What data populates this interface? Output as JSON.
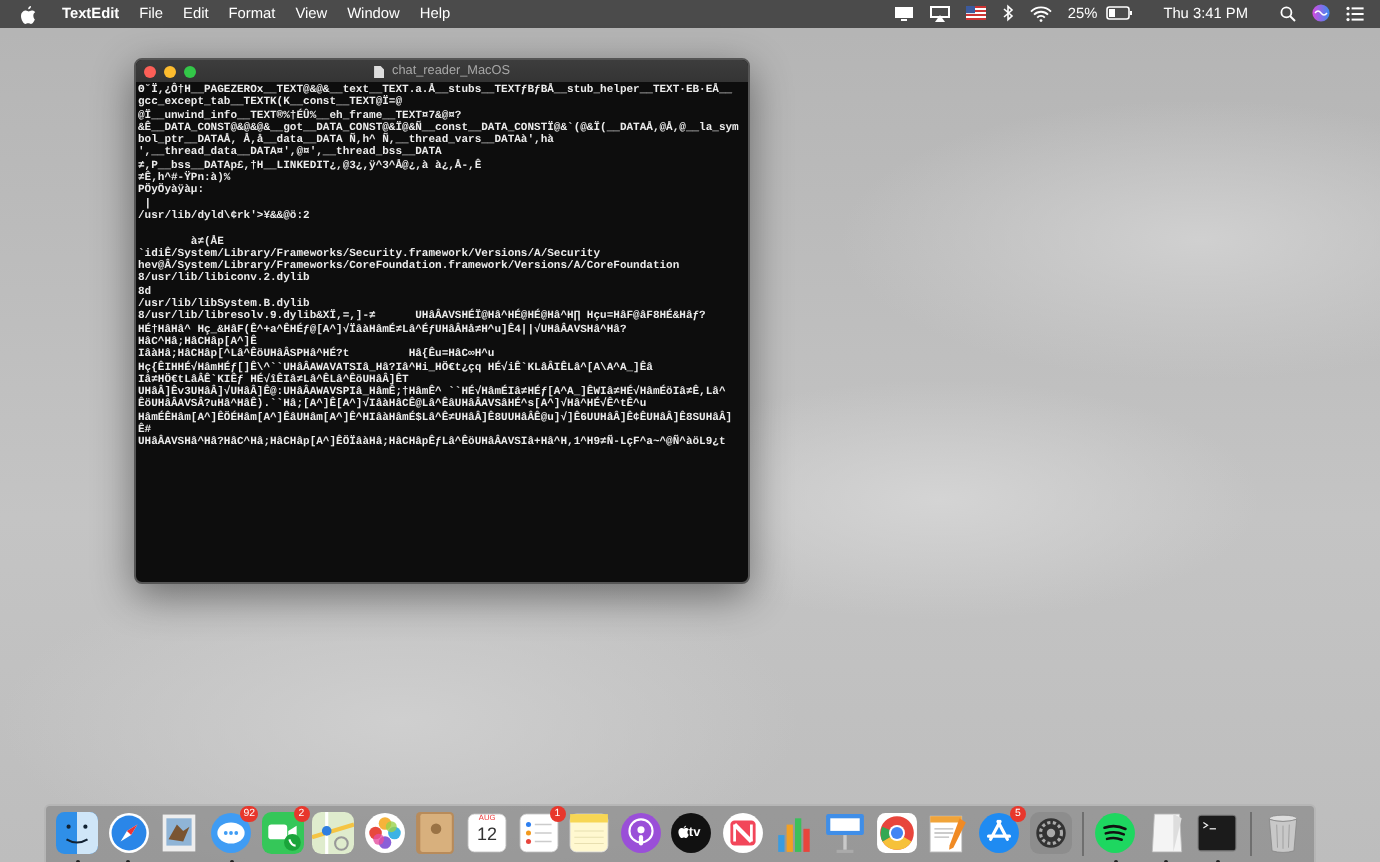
{
  "menu_bar": {
    "app_name": "TextEdit",
    "menus": [
      "File",
      "Edit",
      "Format",
      "View",
      "Window",
      "Help"
    ],
    "battery_percent": "25%",
    "clock": "Thu 3:41 PM"
  },
  "window": {
    "title": "chat_reader_MacOS",
    "lines": [
      "ʘ˘Ï,¿Ô†H__PAGEZEROx__TEXT@&@&__text__TEXT.a.Å__stubs__TEXTƒBƒBÅ__stub_helper__TEXT·EB·EÅ__",
      "gcc_except_tab__TEXTK(K__const__TEXT@Ï=@",
      "@Ï__unwind_info__TEXT®%†ÉÛ%__eh_frame__TEXT¤7&@¤?",
      "&Ê__DATA_CONST@&@&@&__got__DATA_CONST@&Ï@&Ñ__const__DATA_CONSTÏ@&`(@&Ï(__DATAÅ,@Å,@__la_sym",
      "bol_ptr__DATAÅ, Å,å__data__DATA Ñ,h^ Ñ,__thread_vars__DATAà',hà",
      "',__thread_data__DATA¤',@¤',__thread_bss__DATA",
      "≠,P__bss__DATAp£,†H__LINKEDIT¿,@3¿,ÿ^3^Å@¿,à à¿,Å-,Ê",
      "≠Ê,h^#-ŸPn:à)%",
      "PÖyÖyàÿàµ:",
      " |",
      "/usr/lib/dyld\\¢rk'>¥&&@ö:2",
      "        à≠(ÅE",
      "`idiÊ/System/Library/Frameworks/Security.framework/Versions/A/Security",
      "hev@Â/System/Library/Frameworks/CoreFoundation.framework/Versions/A/CoreFoundation",
      "8/usr/lib/libiconv.2.dylib",
      "8d",
      "/usr/lib/libSystem.B.dylib",
      "8/usr/lib/libresolv.9.dylib&XÏ,=,]-≠      UHâÂAVSHÉÏ@Hâ^HÉ@HÉ@Hâ^H∏ Hçu=HâF@âF8HÉ&Hâƒ?",
      "HÉ†HâHâ^ Hç_&HâF(Ê^+a^ÊHÉƒ@[A^]√ÏâàHâmÉ≠Lâ^ÉƒUHâÂHå≠H^u]Ê4||√UHâÂAVSHâ^Hâ?",
      "HâC^Hâ;HâCHâp[A^]Ê",
      "IâàHâ;HâCHâp[^Lâ^ÊöUHâÂSPHâ^HÉ?t         Hâ{Êu=HâC∞H^u",
      "Hç{ÊIHHÉ√HâmHÉƒ[]Ê\\^``UHâÂAWAVATSIâ_Hâ?Iâ^Hi_HÖ€t¿çq HÉ√iÊ`KLâÂIÊLâ^[A\\A^A_]Êâ",
      "Iâ≠HÖ€tLâÂÊ`KIÊƒ HÉ√îÊIâ≠Lâ^ÊLâ^ÊöUHâÂ]ÊT",
      "UHâÂ]Êv3UHâÂ]√UHâÂ]Ê@:UHâÂAWAVSPIâ_HâmÊ;†HâmÊ^ ``HÉ√HâmÉIâ≠HÉƒ[A^A_]ÊWIâ≠HÉ√HâmÉöIâ≠Ê,Lâ^",
      "ÊöUHâÂAVSÂ?uHâ^HâÊ).``Hâ;[A^]Ê[A^]√IâàHâCÊ@Lâ^ÊâUHâÂAVSâHÉ^s[A^]√Hâ^HÉ√Ê^tÊ^u",
      "HâmÉÊHâm[A^]ÊÖÉHâm[A^]ÊâUHâm[A^]Ê^HIâàHâmÉ$Lâ^Ê≠UHâÂ]Ê8UUHâÂÊ@u]√]Ê6UUHâÂ]Ê¢ÊUHâÂ]Ê8SUHâÂ]",
      "Ê#",
      "UHâÂAVSHâ^Hâ?HâC^Hâ;HâCHâp[A^]ÊÖÏâàHâ;HâCHâpÊƒLâ^ÊöUHâÂAVSIâ+Hâ^H,1^H9≠Ñ-LçF^a~^@Ñ^àöL9¿t"
    ]
  },
  "dock": {
    "sections": [
      [
        {
          "kind": "finder",
          "running": true
        },
        {
          "kind": "safari",
          "running": true
        },
        {
          "kind": "preview",
          "running": false
        },
        {
          "kind": "messages",
          "running": true,
          "badge": "92"
        },
        {
          "kind": "facetime",
          "running": false,
          "badge": "2"
        },
        {
          "kind": "maps",
          "running": false
        },
        {
          "kind": "photos",
          "running": false
        },
        {
          "kind": "contacts",
          "running": false
        },
        {
          "kind": "calendar",
          "running": false,
          "month": "AUG",
          "day": "12"
        },
        {
          "kind": "reminders",
          "running": false,
          "badge": "1"
        },
        {
          "kind": "notes",
          "running": false
        },
        {
          "kind": "podcasts",
          "running": false
        },
        {
          "kind": "tv",
          "running": false,
          "caption": "tv"
        },
        {
          "kind": "news",
          "running": false
        },
        {
          "kind": "numbers",
          "running": false
        },
        {
          "kind": "keynote",
          "running": false
        },
        {
          "kind": "chrome",
          "running": false
        },
        {
          "kind": "pages",
          "running": false
        },
        {
          "kind": "appstore",
          "running": false,
          "badge": "5"
        },
        {
          "kind": "settings",
          "running": false
        }
      ],
      [
        {
          "kind": "spotify",
          "running": true
        },
        {
          "kind": "textedit",
          "running": true
        },
        {
          "kind": "terminal",
          "running": true
        }
      ],
      [
        {
          "kind": "trash",
          "running": false
        }
      ]
    ]
  }
}
